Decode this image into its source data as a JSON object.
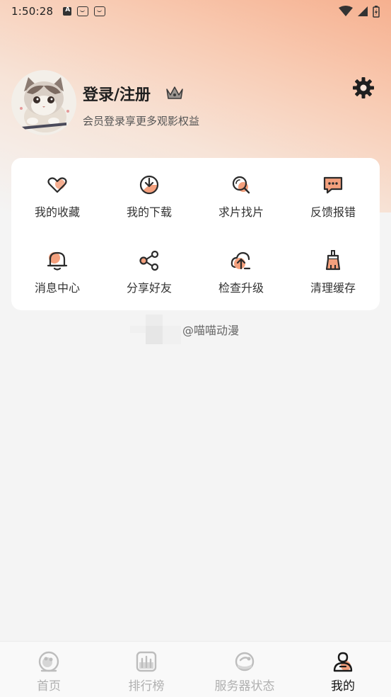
{
  "status_bar": {
    "time": "1:50:28"
  },
  "profile": {
    "username": "登录/注册",
    "subtitle": "会员登录享更多观影权益"
  },
  "features": [
    {
      "label": "我的收藏",
      "icon": "heart-icon"
    },
    {
      "label": "我的下载",
      "icon": "download-icon"
    },
    {
      "label": "求片找片",
      "icon": "search-film-icon"
    },
    {
      "label": "反馈报错",
      "icon": "feedback-icon"
    },
    {
      "label": "消息中心",
      "icon": "bell-icon"
    },
    {
      "label": "分享好友",
      "icon": "share-icon"
    },
    {
      "label": "检查升级",
      "icon": "upgrade-icon"
    },
    {
      "label": "清理缓存",
      "icon": "clean-cache-icon"
    }
  ],
  "watermark": {
    "text": "@喵喵动漫"
  },
  "tabs": [
    {
      "label": "首页",
      "icon": "home-icon",
      "active": false
    },
    {
      "label": "排行榜",
      "icon": "ranking-icon",
      "active": false
    },
    {
      "label": "服务器状态",
      "icon": "server-status-icon",
      "active": false
    },
    {
      "label": "我的",
      "icon": "profile-icon",
      "active": true
    }
  ],
  "colors": {
    "accent": "#f4a07d",
    "icon_stroke": "#2b2b2b",
    "tab_inactive": "#b0b0b0",
    "tab_active": "#111111"
  }
}
